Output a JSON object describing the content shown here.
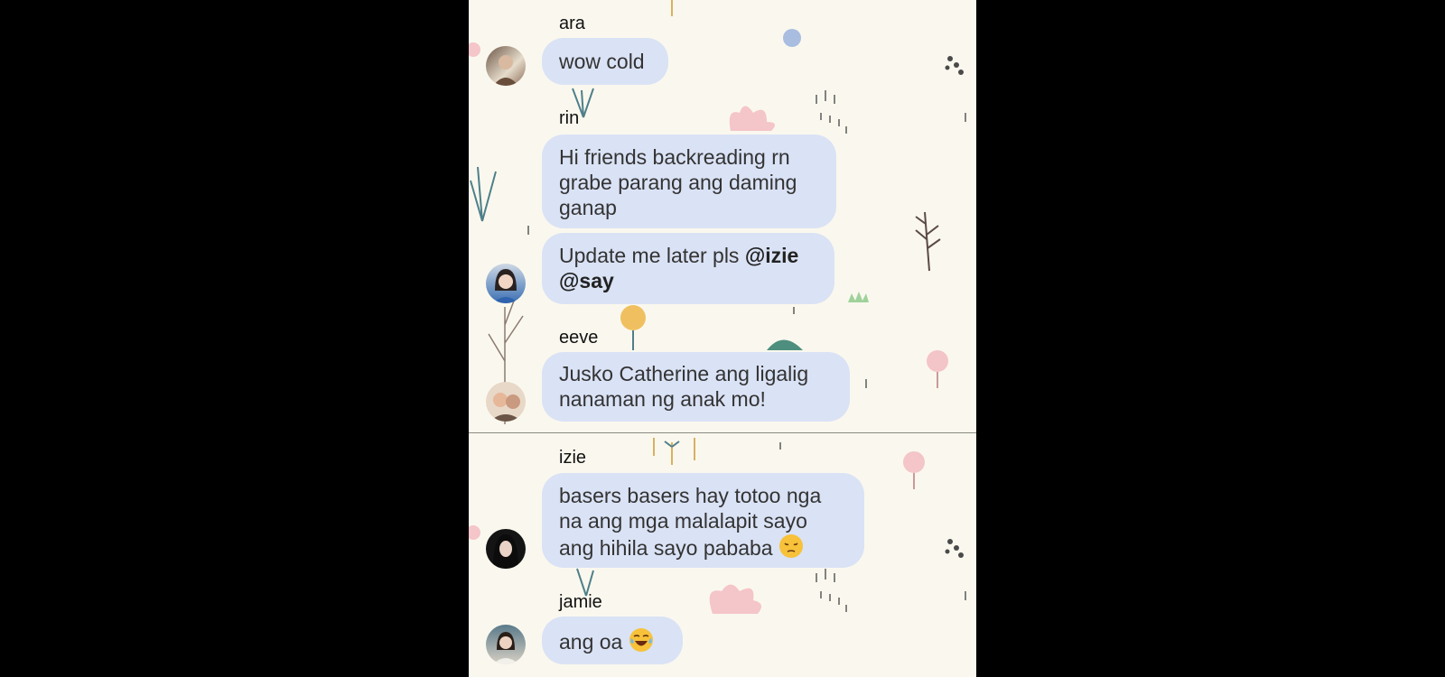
{
  "messages": [
    {
      "sender": "ara",
      "lines": [
        "wow cold"
      ]
    },
    {
      "sender": "rin",
      "lines": [
        "Hi friends backreading rn grabe parang ang daming ganap"
      ],
      "second_text": "Update me later pls",
      "mention1": "@izie",
      "mention2": "@say"
    },
    {
      "sender": "eeve",
      "lines": [
        "Jusko Catherine ang ligalig nanaman ng anak mo!"
      ]
    },
    {
      "sender": "izie",
      "text": "basers basers hay totoo nga na ang mga malalapit sayo ang hihila sayo pababa",
      "emoji": "pensive-face"
    },
    {
      "sender": "jamie",
      "text": "ang oa",
      "emoji": "tears-of-joy-face"
    }
  ],
  "colors": {
    "background": "#faf8ee",
    "bubble": "#dae2f5",
    "outer": "#000000"
  }
}
